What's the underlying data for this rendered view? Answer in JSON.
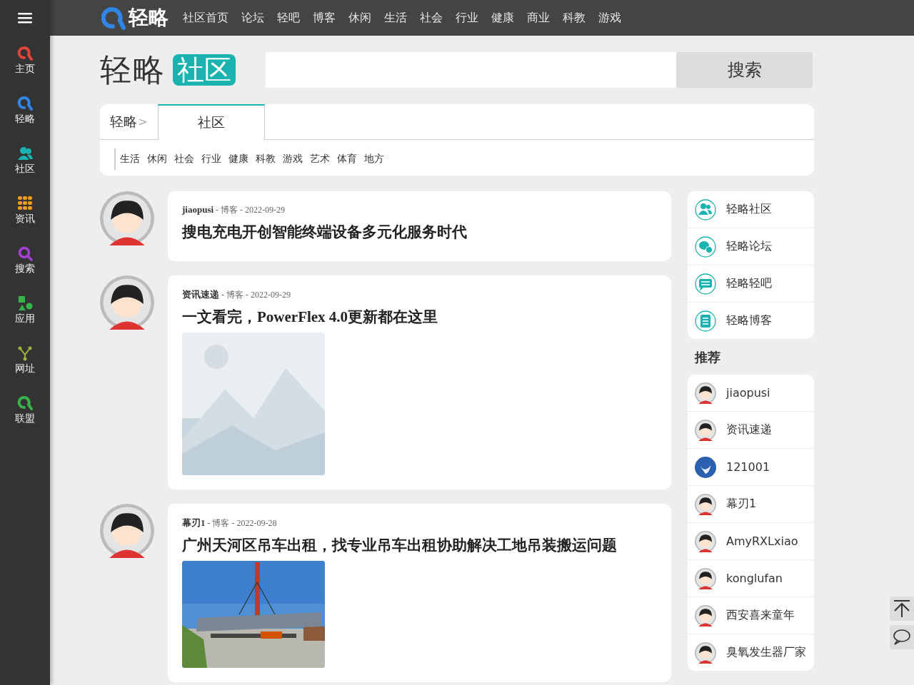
{
  "sidebar": {
    "items": [
      {
        "label": "主页",
        "kind": "home"
      },
      {
        "label": "轻略",
        "kind": "brand"
      },
      {
        "label": "社区",
        "kind": "community"
      },
      {
        "label": "资讯",
        "kind": "news"
      },
      {
        "label": "搜索",
        "kind": "search"
      },
      {
        "label": "应用",
        "kind": "apps"
      },
      {
        "label": "网址",
        "kind": "links"
      },
      {
        "label": "联盟",
        "kind": "alliance"
      }
    ]
  },
  "top_bar": {
    "logo": "轻略",
    "nav": [
      "社区首页",
      "论坛",
      "轻吧",
      "博客",
      "休闲",
      "生活",
      "社会",
      "行业",
      "健康",
      "商业",
      "科教",
      "游戏"
    ]
  },
  "header": {
    "brand": "轻略",
    "badge": "社区",
    "search_button": "搜索"
  },
  "breadcrumb": {
    "root": "轻略",
    "separator": ">",
    "tabs": [
      {
        "label": "社区",
        "selected": true
      }
    ],
    "categories": [
      "生活",
      "休闲",
      "社会",
      "行业",
      "健康",
      "科教",
      "游戏",
      "艺术",
      "体育",
      "地方"
    ]
  },
  "posts": [
    {
      "meta": "**jiaopusi** - 博客 - 2022-09-29",
      "title": "搜电充电开创智能终端设备多元化服务时代",
      "kind": "text"
    },
    {
      "meta": "**资讯速递** - 博客 - 2022-09-29",
      "title": "一文看完，PowerFlex 4.0更新都在这里",
      "kind": "placeholder"
    },
    {
      "meta": "**幕刃1** - 博客 - 2022-09-28",
      "title": "广州天河区吊车出租，找专业吊车出租协助解决工地吊装搬运问题"
    }
  ],
  "links": [
    {
      "label": "轻略社区",
      "kind": "people"
    },
    {
      "label": "轻略论坛",
      "kind": "chat"
    },
    {
      "label": "轻略轻吧",
      "kind": "message"
    },
    {
      "label": "轻略博客",
      "kind": "document"
    }
  ],
  "recommend": {
    "heading": "推荐",
    "users": [
      {
        "name": "jiaopusi",
        "kind": "figure"
      },
      {
        "name": "资讯速递",
        "kind": "figure"
      },
      {
        "name": "121001",
        "kind": "blue"
      },
      {
        "name": "幕刃1",
        "kind": "figure"
      },
      {
        "name": "AmyRXLxiao",
        "kind": "figure"
      },
      {
        "name": "konglufan",
        "kind": "figure"
      },
      {
        "name": "西安喜来童年",
        "kind": "figure"
      },
      {
        "name": "臭氧发生器厂家",
        "kind": "figure"
      }
    ]
  }
}
